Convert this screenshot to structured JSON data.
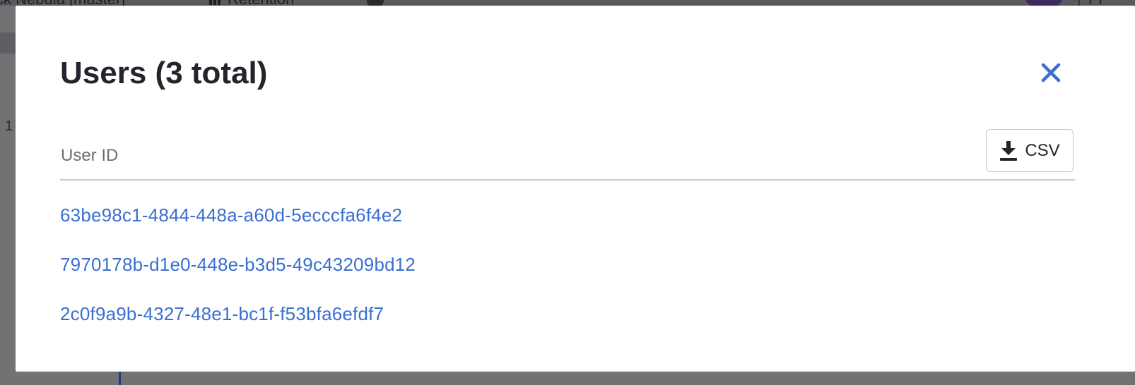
{
  "background": {
    "project_name": "ck Nebula [master]",
    "page_name": "Retention",
    "right_text": "Pr",
    "row_number": "1"
  },
  "modal": {
    "title": "Users (3 total)",
    "close_icon": "close-icon",
    "column_header": "User ID",
    "csv_button": {
      "icon": "download-icon",
      "label": "CSV"
    },
    "users": [
      "63be98c1-4844-448a-a60d-5ecccfa6f4e2",
      "7970178b-d1e0-448e-b3d5-49c43209bd12",
      "2c0f9a9b-4327-48e1-bc1f-f53bfa6efdf7"
    ]
  },
  "colors": {
    "link": "#3a6fd1",
    "title": "#22252b",
    "overlay": "#727275",
    "close_icon": "#3a6fd1"
  }
}
